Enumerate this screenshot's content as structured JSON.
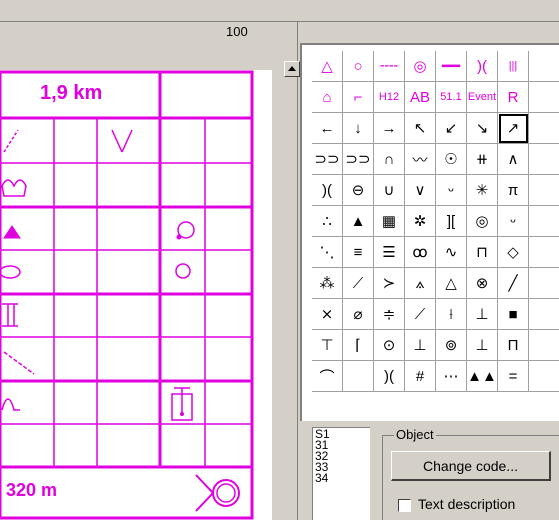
{
  "toolbar": {
    "zoom": "100"
  },
  "card": {
    "distance": "1,9 km",
    "climb": "320 m",
    "color": "#e000e0"
  },
  "palette": {
    "rows": [
      [
        "△",
        "○",
        "╌╌",
        "◎",
        "━━",
        ")(",
        "|||",
        ""
      ],
      [
        "⌂",
        "⌐",
        "H12",
        "AB",
        "51.1",
        "Event",
        "R",
        ""
      ],
      [
        "←",
        "↓",
        "→",
        "↖",
        "↙",
        "↘",
        "↗",
        ""
      ],
      [
        "⊃⊃",
        "⊃⊃",
        "∩",
        "〰",
        "☉",
        "⧺",
        "∧",
        ""
      ],
      [
        ")(",
        "⊖",
        "∪",
        "∨",
        "ᵕ",
        "✳",
        "π",
        ""
      ],
      [
        "∴",
        "▲",
        "▦",
        "✲",
        "][",
        "◎",
        "ᵕ",
        ""
      ],
      [
        "⋱",
        "≡",
        "☰",
        "ꝏ",
        "∿",
        "⊓",
        "◇",
        ""
      ],
      [
        "⁂",
        "⟋",
        "≻",
        "⟑",
        "△",
        "⊗",
        "╱",
        ""
      ],
      [
        "⨯",
        "⌀",
        "≑",
        "⟋",
        "⟊",
        "⊥",
        "■",
        ""
      ],
      [
        "⊤",
        "⌈",
        "⊙",
        "⊥",
        "⊚",
        "⊥",
        "Π",
        ""
      ],
      [
        "⌒",
        "",
        ")(",
        "#",
        "⋯",
        "▲▲",
        "=",
        ""
      ]
    ]
  },
  "code_list": {
    "items": [
      "S1",
      "31",
      "32",
      "33",
      "34"
    ]
  },
  "object_group": {
    "title": "Object",
    "change_code": "Change code...",
    "text_description": "Text description"
  }
}
